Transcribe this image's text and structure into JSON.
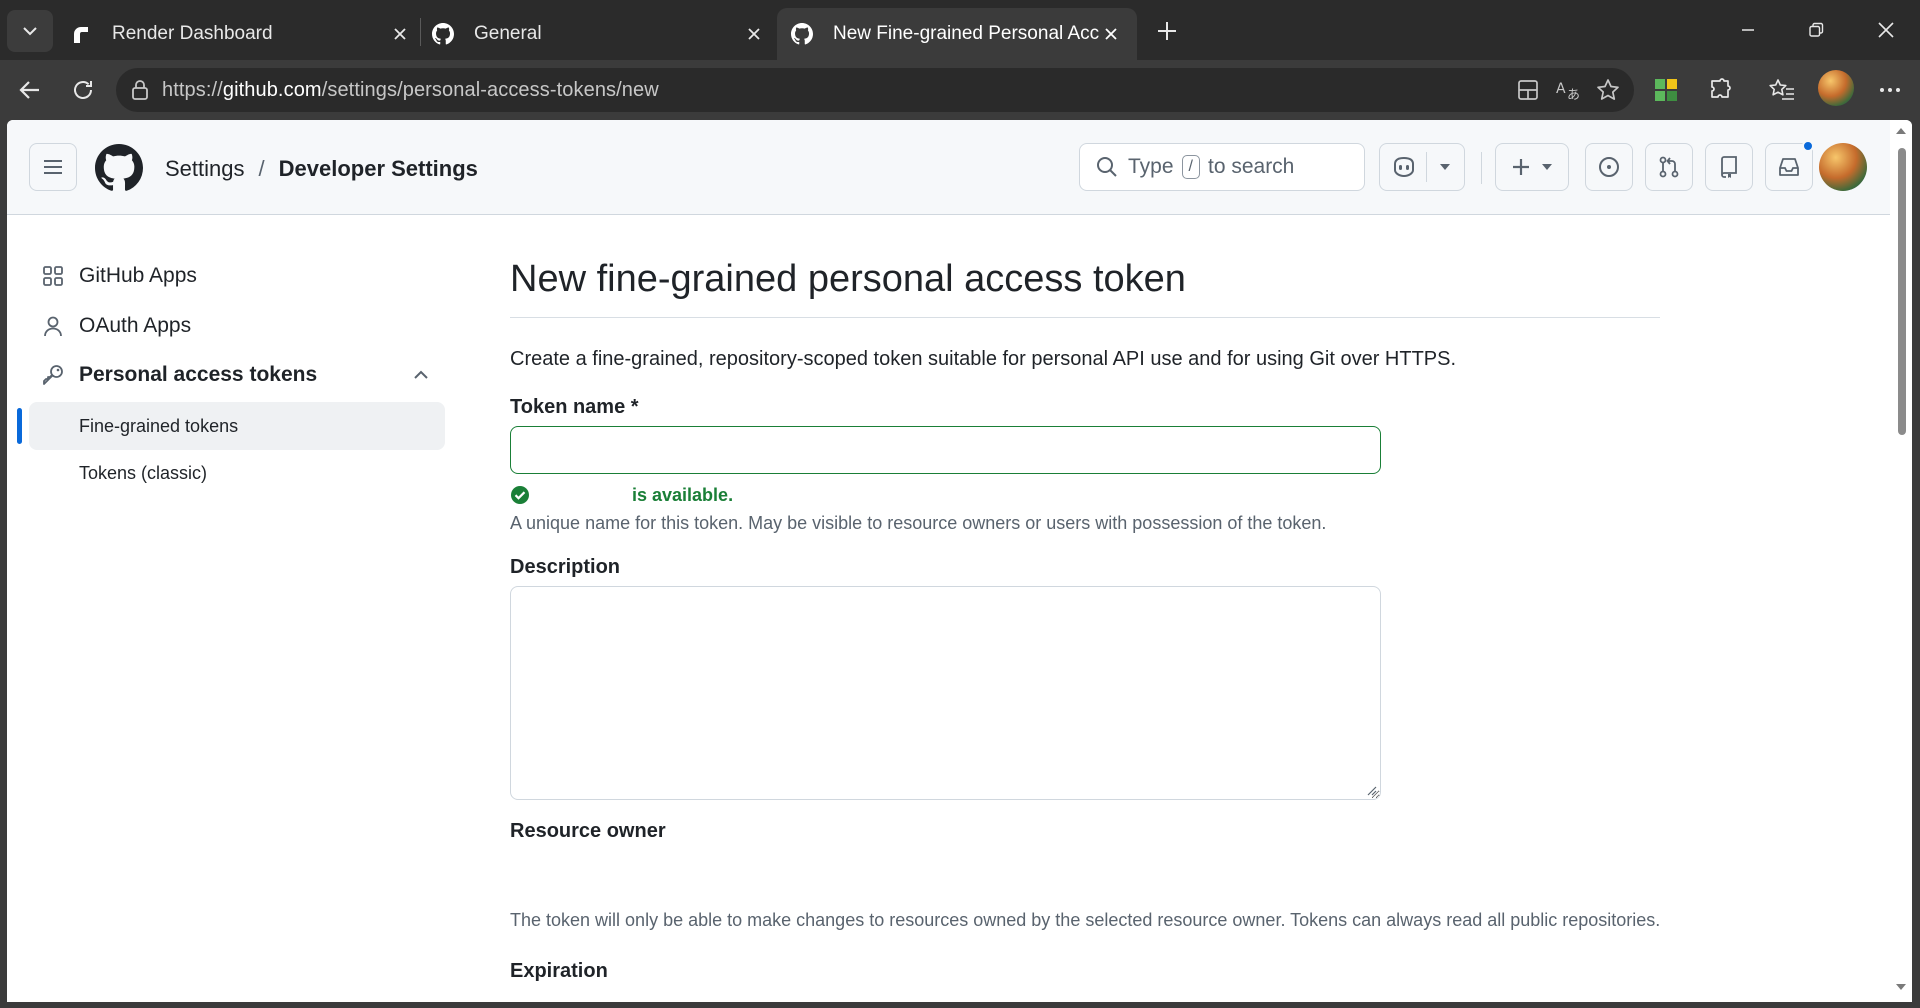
{
  "browser": {
    "tabs": [
      {
        "title": "Render Dashboard",
        "icon": "render-icon",
        "active": false
      },
      {
        "title": "General",
        "icon": "github-icon",
        "active": false
      },
      {
        "title": "New Fine-grained Personal Access",
        "icon": "github-icon",
        "active": true
      }
    ],
    "url_prefix": "https://",
    "url_host": "github.com",
    "url_path": "/settings/personal-access-tokens/new"
  },
  "header": {
    "breadcrumb": [
      "Settings",
      "Developer Settings"
    ],
    "search_type": "Type",
    "search_key": "/",
    "search_rest": "to search",
    "notification_color": "#0969da"
  },
  "sidebar": {
    "items": [
      {
        "label": "GitHub Apps",
        "icon": "apps-grid-icon"
      },
      {
        "label": "OAuth Apps",
        "icon": "person-icon"
      },
      {
        "label": "Personal access tokens",
        "icon": "key-icon",
        "expanded": true
      }
    ],
    "subitems": [
      {
        "label": "Fine-grained tokens",
        "active": true
      },
      {
        "label": "Tokens (classic)",
        "active": false
      }
    ],
    "active_color": "#0969da"
  },
  "main": {
    "title": "New fine-grained personal access token",
    "lead": "Create a fine-grained, repository-scoped token suitable for personal API use and for using Git over HTTPS.",
    "token_name_label": "Token name *",
    "token_name_value": "",
    "availability": "is available.",
    "availability_color": "#1a7f37",
    "token_name_note": "A unique name for this token. May be visible to resource owners or users with possession of the token.",
    "description_label": "Description",
    "description_value": "",
    "resource_owner_label": "Resource owner",
    "resource_owner_note": "The token will only be able to make changes to resources owned by the selected resource owner. Tokens can always read all public repositories.",
    "expiration_label": "Expiration"
  }
}
